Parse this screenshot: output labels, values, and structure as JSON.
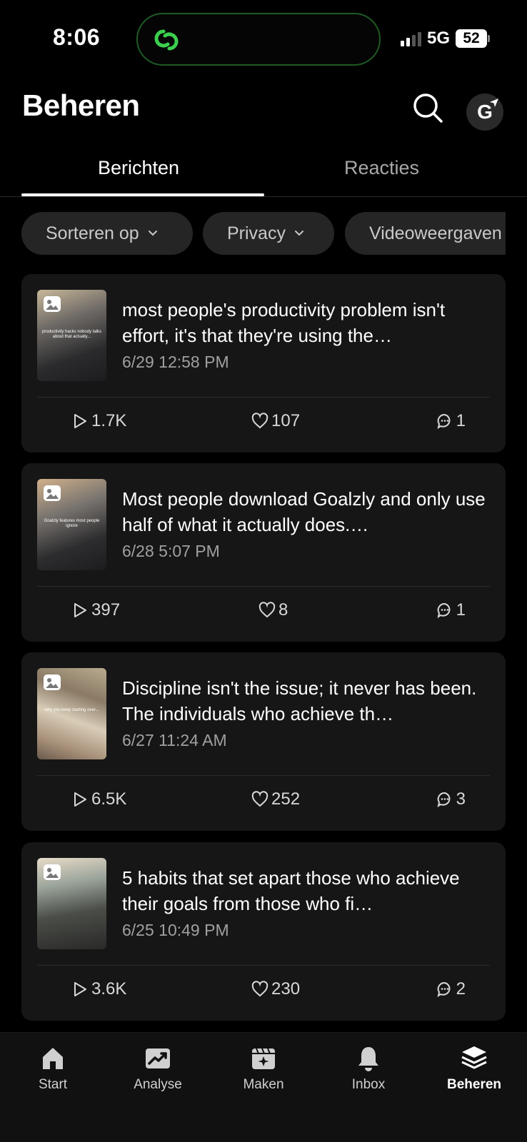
{
  "status_bar": {
    "time": "8:06",
    "network": "5G",
    "battery": "52"
  },
  "header": {
    "title": "Beheren",
    "avatar_letter": "G"
  },
  "tabs": [
    {
      "label": "Berichten",
      "active": true
    },
    {
      "label": "Reacties",
      "active": false
    }
  ],
  "filters": [
    {
      "label": "Sorteren op"
    },
    {
      "label": "Privacy"
    },
    {
      "label": "Videoweergaven"
    }
  ],
  "posts": [
    {
      "title": "most people's productivity problem isn't effort, it's that they're using the…",
      "date": "6/29 12:58 PM",
      "views": "1.7K",
      "likes": "107",
      "comments": "1",
      "thumb_caption": "productivity hacks nobody talks about that actually..."
    },
    {
      "title": "Most people download Goalzly and only use half of what it actually does.…",
      "date": "6/28 5:07 PM",
      "views": "397",
      "likes": "8",
      "comments": "1",
      "thumb_caption": "Goalzly features most people ignore"
    },
    {
      "title": "Discipline isn't the issue; it never has been. The individuals who achieve th…",
      "date": "6/27 11:24 AM",
      "views": "6.5K",
      "likes": "252",
      "comments": "3",
      "thumb_caption": "why you keep starting over..."
    },
    {
      "title": "5 habits that set apart those who achieve their goals from those who fi…",
      "date": "6/25 10:49 PM",
      "views": "3.6K",
      "likes": "230",
      "comments": "2",
      "thumb_caption": ""
    }
  ],
  "bottom_nav": [
    {
      "label": "Start",
      "icon": "home-icon",
      "active": false
    },
    {
      "label": "Analyse",
      "icon": "chart-icon",
      "active": false
    },
    {
      "label": "Maken",
      "icon": "create-icon",
      "active": false
    },
    {
      "label": "Inbox",
      "icon": "bell-icon",
      "active": false
    },
    {
      "label": "Beheren",
      "icon": "layers-icon",
      "active": true
    }
  ],
  "colors": {
    "background": "#000000",
    "card": "#161616",
    "chip": "#252525",
    "island_border": "#1f5a24",
    "island_icon": "#3ccf4e"
  }
}
